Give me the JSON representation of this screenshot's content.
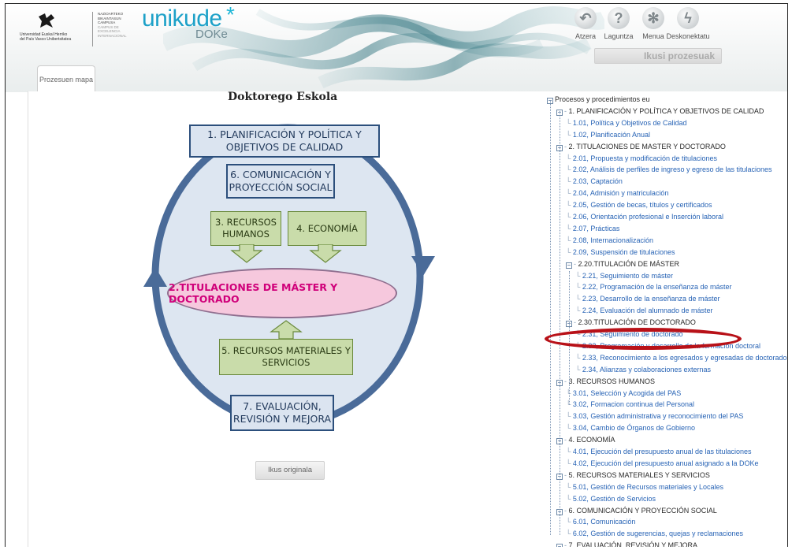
{
  "header": {
    "upv_text": [
      "Universidad",
      "del País Vasco",
      "Euskal Herriko",
      "Unibertsitatea"
    ],
    "bik_text": [
      "NAZIOARTEKO",
      "BIKAINTASUN",
      "CAMPUSA",
      "CAMPUS DE",
      "EXCELENCIA",
      "INTERNACIONAL"
    ],
    "brand_main": "unikude",
    "brand_star": "*",
    "brand_sub": "DOKe",
    "brand_color": "#1da1c8",
    "toolbar": [
      {
        "label": "Atzera",
        "icon": "undo-icon"
      },
      {
        "label": "Laguntza",
        "icon": "question-icon"
      },
      {
        "label": "Menua",
        "icon": "asterisk-icon"
      },
      {
        "label": "Deskonektatu",
        "icon": "lightning-icon"
      }
    ],
    "ikusi_button": "Ikusi prozesuak",
    "tab_label": "Prozesuen mapa"
  },
  "diagram": {
    "title": "Doktorego Eskola",
    "box1": "1.  PLANIFICACIÓN Y POLÍTICA Y OBJETIVOS DE CALIDAD",
    "box6": "6. COMUNICACIÓN Y PROYECCIÓN SOCIAL",
    "box3": "3. RECURSOS HUMANOS",
    "box4": "4. ECONOMÍA",
    "center": "2.TITULACIONES DE MÁSTER Y DOCTORADO",
    "box5": "5. RECURSOS MATERIALES Y SERVICIOS",
    "box7": "7. EVALUACIÓN, REVISIÓN Y MEJORA",
    "original_button": "Ikus originala",
    "colors": {
      "blue": "#4a6b99",
      "green": "#c9dcaa",
      "pink": "#f6c8dd",
      "magenta": "#d0007a"
    }
  },
  "tree": {
    "root": "Procesos y procedimientos eu",
    "items": [
      "1. PLANIFICACIÓN Y POLÍTICA Y OBJETIVOS DE CALIDAD",
      "1.01, Política y Objetivos de Calidad",
      "1.02, Planificación Anual",
      "2. TITULACIONES DE MASTER Y DOCTORADO",
      "2.01, Propuesta y modificación de titulaciones",
      "2.02, Análisis de perfiles de ingreso y egreso de las titulaciones",
      "2.03, Captación",
      "2.04, Admisión y matriculación",
      "2.05, Gestión de becas, títulos y certificados",
      "2.06, Orientación profesional e Inserción laboral",
      "2.07, Prácticas",
      "2.08, Internacionalización",
      "2.09, Suspensión de titulaciones",
      "2.20.TITULACIÓN DE MÁSTER",
      "2.21, Seguimiento de máster",
      "2.22, Programación de la enseñanza de máster",
      "2.23, Desarrollo de la enseñanza de máster",
      "2.24, Evaluación del alumnado de máster",
      "2.30.TITULACIÓN DE DOCTORADO",
      "2.31, Seguimiento de doctorado",
      "2.32, Programación y desarrollo de la formación doctoral",
      "2.33, Reconocimiento a los egresados y egresadas de doctorado",
      "2.34, Alianzas y colaboraciones externas",
      "3. RECURSOS HUMANOS",
      "3.01, Selección y Acogida del PAS",
      "3.02, Formacion continua del Personal",
      "3.03, Gestión administrativa y reconocimiento del PAS",
      "3.04, Cambio de Órganos de Gobierno",
      "4. ECONOMÍA",
      "4.01, Ejecución del presupuesto anual de las titulaciones",
      "4.02, Ejecución del presupuesto anual asignado a la DOKe",
      "5. RECURSOS MATERIALES Y SERVICIOS",
      "5.01, Gestión de Recursos materiales y Locales",
      "5.02, Gestión de Servicios",
      "6. COMUNICACIÓN Y PROYECCIÓN SOCIAL",
      "6.01, Comunicación",
      "6.02, Gestión de sugerencias, quejas y reclamaciones",
      "7. EVALUACIÓN, REVISIÓN Y MEJORA"
    ],
    "highlight_color": "#b81118"
  }
}
